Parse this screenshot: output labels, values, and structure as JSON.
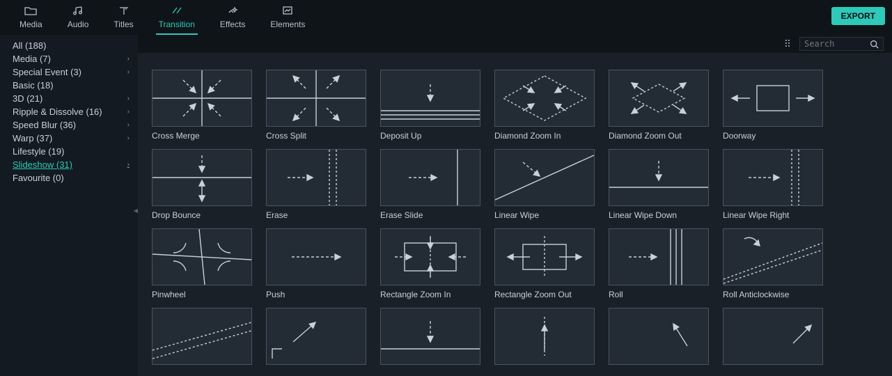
{
  "nav": {
    "items": [
      {
        "id": "media",
        "label": "Media"
      },
      {
        "id": "audio",
        "label": "Audio"
      },
      {
        "id": "titles",
        "label": "Titles"
      },
      {
        "id": "transition",
        "label": "Transition",
        "active": true
      },
      {
        "id": "effects",
        "label": "Effects"
      },
      {
        "id": "elements",
        "label": "Elements"
      }
    ],
    "export_label": "EXPORT"
  },
  "sidebar": {
    "items": [
      {
        "label": "All (188)",
        "chevron": false
      },
      {
        "label": "Media (7)",
        "chevron": true
      },
      {
        "label": "Special Event (3)",
        "chevron": true
      },
      {
        "label": "Basic (18)",
        "chevron": false
      },
      {
        "label": "3D (21)",
        "chevron": true
      },
      {
        "label": "Ripple & Dissolve (16)",
        "chevron": true
      },
      {
        "label": "Speed Blur (36)",
        "chevron": true
      },
      {
        "label": "Warp (37)",
        "chevron": true
      },
      {
        "label": "Lifestyle (19)",
        "chevron": false
      },
      {
        "label": "Slideshow (31)",
        "chevron": true,
        "active": true
      },
      {
        "label": "Favourite (0)",
        "chevron": false
      }
    ]
  },
  "toolbar": {
    "search_placeholder": "Search"
  },
  "transitions": [
    {
      "label": "Cross Merge"
    },
    {
      "label": "Cross Split"
    },
    {
      "label": "Deposit Up"
    },
    {
      "label": "Diamond Zoom In"
    },
    {
      "label": "Diamond Zoom Out"
    },
    {
      "label": "Doorway"
    },
    {
      "label": "Drop Bounce"
    },
    {
      "label": "Erase"
    },
    {
      "label": "Erase Slide"
    },
    {
      "label": "Linear Wipe"
    },
    {
      "label": "Linear Wipe Down"
    },
    {
      "label": "Linear Wipe Right"
    },
    {
      "label": "Pinwheel"
    },
    {
      "label": "Push"
    },
    {
      "label": "Rectangle Zoom In"
    },
    {
      "label": "Rectangle Zoom Out"
    },
    {
      "label": "Roll"
    },
    {
      "label": "Roll Anticlockwise"
    },
    {
      "label": ""
    },
    {
      "label": ""
    },
    {
      "label": ""
    },
    {
      "label": ""
    },
    {
      "label": ""
    },
    {
      "label": ""
    }
  ]
}
